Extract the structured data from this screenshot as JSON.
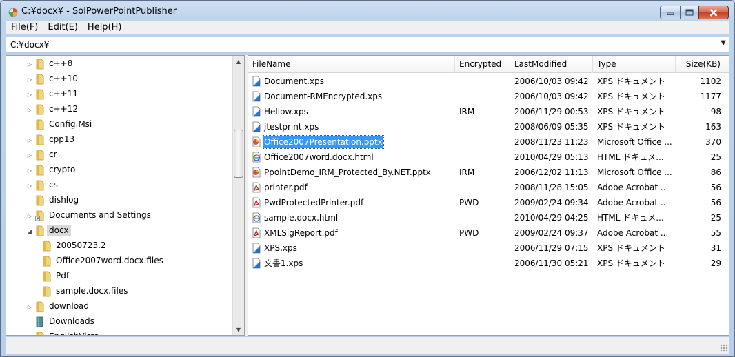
{
  "window": {
    "title": "C:¥docx¥ - SolPowerPointPublisher"
  },
  "menu": [
    "File(F)",
    "Edit(E)",
    "Help(H)"
  ],
  "path": {
    "value": "C:¥docx¥"
  },
  "tree": {
    "items": [
      {
        "label": "c++8",
        "expander": "collapsed",
        "icon": "folder-icon"
      },
      {
        "label": "c++10",
        "expander": "collapsed",
        "icon": "folder-icon"
      },
      {
        "label": "c++11",
        "expander": "collapsed",
        "icon": "folder-icon"
      },
      {
        "label": "c++12",
        "expander": "collapsed",
        "icon": "folder-icon"
      },
      {
        "label": "Config.Msi",
        "expander": "none",
        "icon": "folder-icon"
      },
      {
        "label": "cpp13",
        "expander": "collapsed",
        "icon": "folder-icon"
      },
      {
        "label": "cr",
        "expander": "collapsed",
        "icon": "folder-icon"
      },
      {
        "label": "crypto",
        "expander": "collapsed",
        "icon": "folder-icon"
      },
      {
        "label": "cs",
        "expander": "collapsed",
        "icon": "folder-icon"
      },
      {
        "label": "dishlog",
        "expander": "none",
        "icon": "folder-icon"
      },
      {
        "label": "Documents and Settings",
        "expander": "collapsed",
        "icon": "folder-shortcut-icon"
      },
      {
        "label": "docx",
        "expander": "expanded",
        "icon": "folder-icon",
        "selected": true
      },
      {
        "label": "20050723.2",
        "expander": "none",
        "icon": "folder-icon",
        "child": true
      },
      {
        "label": "Office2007word.docx.files",
        "expander": "none",
        "icon": "folder-icon",
        "child": true
      },
      {
        "label": "Pdf",
        "expander": "none",
        "icon": "folder-icon",
        "child": true
      },
      {
        "label": "sample.docx.files",
        "expander": "none",
        "icon": "folder-icon",
        "child": true
      },
      {
        "label": "download",
        "expander": "collapsed",
        "icon": "folder-icon"
      },
      {
        "label": "Downloads",
        "expander": "none",
        "icon": "downloads-folder-icon"
      },
      {
        "label": "EnglishVista",
        "expander": "collapsed",
        "icon": "folder-icon"
      }
    ]
  },
  "list": {
    "columns": [
      "FileName",
      "Encrypted",
      "LastModified",
      "Type",
      "Size(KB)"
    ],
    "rows": [
      {
        "name": "Document.xps",
        "encrypted": "",
        "modified": "2006/10/03 09:42",
        "type": "XPS ドキュメント",
        "size": "1102",
        "icon": "xps-icon"
      },
      {
        "name": "Document-RMEncrypted.xps",
        "encrypted": "",
        "modified": "2006/10/03 09:42",
        "type": "XPS ドキュメント",
        "size": "1177",
        "icon": "xps-icon"
      },
      {
        "name": "Hellow.xps",
        "encrypted": "IRM",
        "modified": "2006/11/29 00:53",
        "type": "XPS ドキュメント",
        "size": "98",
        "icon": "xps-icon"
      },
      {
        "name": "jtestprint.xps",
        "encrypted": "",
        "modified": "2008/06/09 05:35",
        "type": "XPS ドキュメント",
        "size": "163",
        "icon": "xps-icon"
      },
      {
        "name": "Office2007Presentation.pptx",
        "encrypted": "",
        "modified": "2008/11/23 11:23",
        "type": "Microsoft Office ...",
        "size": "370",
        "icon": "pptx-icon",
        "selected": true
      },
      {
        "name": "Office2007word.docx.html",
        "encrypted": "",
        "modified": "2010/04/29 05:13",
        "type": "HTML ドキュメ...",
        "size": "25",
        "icon": "html-icon"
      },
      {
        "name": "PpointDemo_IRM_Protected_By.NET.pptx",
        "encrypted": "IRM",
        "modified": "2006/12/02 11:13",
        "type": "Microsoft Office ...",
        "size": "86",
        "icon": "pptx-icon"
      },
      {
        "name": "printer.pdf",
        "encrypted": "",
        "modified": "2008/11/28 15:05",
        "type": "Adobe Acrobat ...",
        "size": "56",
        "icon": "pdf-icon"
      },
      {
        "name": "PwdProtectedPrinter.pdf",
        "encrypted": "PWD",
        "modified": "2009/02/24 09:34",
        "type": "Adobe Acrobat ...",
        "size": "56",
        "icon": "pdf-icon"
      },
      {
        "name": "sample.docx.html",
        "encrypted": "",
        "modified": "2010/04/29 04:25",
        "type": "HTML ドキュメ...",
        "size": "25",
        "icon": "html-icon"
      },
      {
        "name": "XMLSigReport.pdf",
        "encrypted": "PWD",
        "modified": "2009/02/24 09:37",
        "type": "Adobe Acrobat ...",
        "size": "55",
        "icon": "pdf-icon"
      },
      {
        "name": "XPS.xps",
        "encrypted": "",
        "modified": "2006/11/29 07:15",
        "type": "XPS ドキュメント",
        "size": "31",
        "icon": "xps-icon"
      },
      {
        "name": "文書1.xps",
        "encrypted": "",
        "modified": "2006/11/30 05:21",
        "type": "XPS ドキュメント",
        "size": "29",
        "icon": "xps-icon"
      }
    ]
  },
  "colors": {
    "selection": "#3399ff",
    "tree_selection": "#d9d9d9",
    "folder": "#e8c253",
    "pdf_red": "#cc1f1f",
    "xps_blue": "#2b6fc6"
  }
}
